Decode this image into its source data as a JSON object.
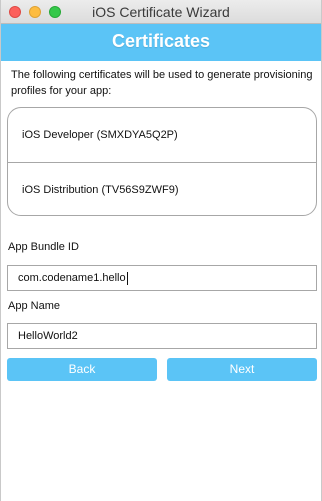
{
  "window": {
    "title": "iOS Certificate Wizard"
  },
  "header": {
    "title": "Certificates"
  },
  "intro": "The following certificates will be used to generate provisioning profiles for your app:",
  "certificates": [
    {
      "label": "iOS Developer (SMXDYA5Q2P)"
    },
    {
      "label": "iOS Distribution (TV56S9ZWF9)"
    }
  ],
  "bundle_id": {
    "label": "App Bundle ID",
    "value": "com.codename1.hello"
  },
  "app_name": {
    "label": "App Name",
    "value": "HelloWorld2"
  },
  "buttons": {
    "back": "Back",
    "next": "Next"
  },
  "colors": {
    "accent": "#5bc4f6"
  }
}
